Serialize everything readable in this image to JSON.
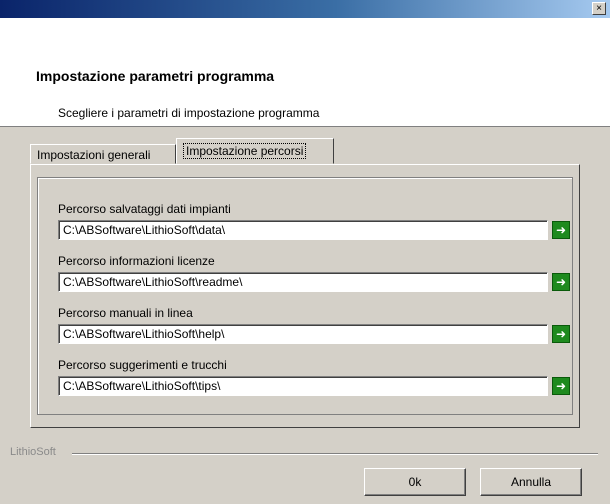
{
  "titlebar": {
    "close_label": "×"
  },
  "header": {
    "title": "Impostazione parametri programma",
    "subtitle": "Scegliere i parametri di impostazione programma"
  },
  "tabs": [
    {
      "label": "Impostazioni generali"
    },
    {
      "label": "Impostazione percorsi"
    }
  ],
  "paths": [
    {
      "label": "Percorso salvataggi dati impianti",
      "value": "C:\\ABSoftware\\LithioSoft\\data\\"
    },
    {
      "label": "Percorso informazioni licenze",
      "value": "C:\\ABSoftware\\LithioSoft\\readme\\"
    },
    {
      "label": "Percorso manuali in linea",
      "value": "C:\\ABSoftware\\LithioSoft\\help\\"
    },
    {
      "label": "Percorso suggerimenti e trucchi",
      "value": "C:\\ABSoftware\\LithioSoft\\tips\\"
    }
  ],
  "go_icon_glyph": "➜",
  "footer": {
    "brand": "LithioSoft",
    "ok_label": "0k",
    "cancel_label": "Annulla"
  },
  "colors": {
    "go_button": "#1e8a1e",
    "titlebar_start": "#0a246a"
  }
}
